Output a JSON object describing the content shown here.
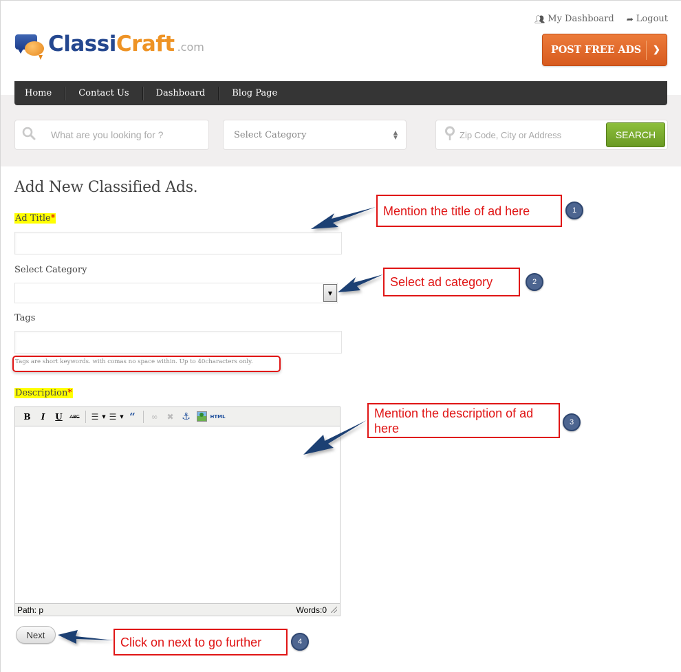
{
  "header": {
    "logo": {
      "part1": "Classi",
      "part2": "Craft",
      "suffix": ".com"
    },
    "top_links": [
      {
        "label": "My Dashboard",
        "icon": "users-icon"
      },
      {
        "label": "Logout",
        "icon": "share-arrow-icon"
      }
    ],
    "post_button": {
      "label": "POST FREE ADS",
      "icon": "chevron-right-icon"
    }
  },
  "nav": {
    "items": [
      "Home",
      "Contact Us",
      "Dashboard",
      "Blog Page"
    ]
  },
  "search": {
    "keyword_placeholder": "What are you looking for ?",
    "category_placeholder": "Select Category",
    "location_placeholder": "Zip Code, City or Address",
    "button_label": "SEARCH"
  },
  "form": {
    "title": "Add New Classified Ads.",
    "ad_title_label": "Ad Title",
    "ad_title_value": "",
    "category_label": "Select Category",
    "category_value": "",
    "tags_label": "Tags",
    "tags_value": "",
    "tags_hint": "Tags are short keywords. with comas no space within. Up to 40characters only.",
    "description_label": "Description",
    "required_mark": "*",
    "editor": {
      "toolbar": [
        "bold",
        "italic",
        "underline",
        "strikethrough",
        "bullet-list",
        "numbered-list",
        "blockquote",
        "link",
        "unlink",
        "anchor",
        "image",
        "html"
      ],
      "path": "Path: p",
      "word_count": "Words:0"
    },
    "next_label": "Next"
  },
  "annotations": [
    {
      "number": "1",
      "text": "Mention the title of ad here"
    },
    {
      "number": "2",
      "text": "Select ad category"
    },
    {
      "number": "3",
      "text": "Mention the description of ad here"
    },
    {
      "number": "4",
      "text": "Click on next to go further"
    }
  ],
  "colors": {
    "accent_orange": "#e06a2b",
    "nav_bg": "#353535",
    "search_green": "#7aab2e",
    "annotation_red": "#e01515",
    "badge_blue": "#4d6590",
    "arrow_blue": "#1f3f73",
    "highlight": "#ffff00"
  }
}
